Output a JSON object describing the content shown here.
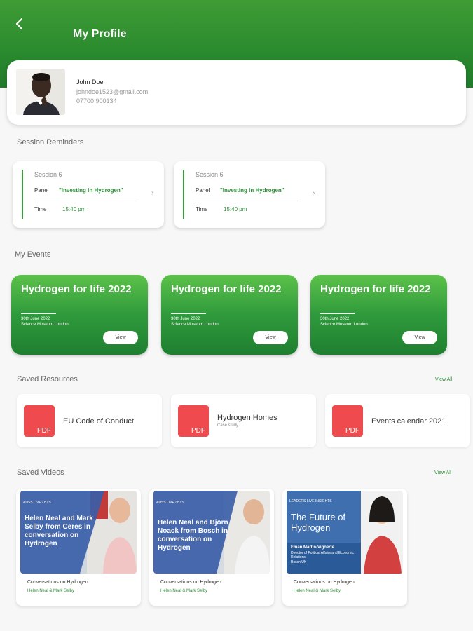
{
  "header": {
    "title": "My Profile",
    "back_icon": "chevron-left-icon"
  },
  "profile": {
    "name": "John Doe",
    "email": "johndoe1523@gmail.com",
    "phone": "07700 900134"
  },
  "sessions": {
    "title": "Session Reminders",
    "items": [
      {
        "title": "Session 6",
        "panel_label": "Panel",
        "panel_value": "\"Investing in Hydrogen\"",
        "time_label": "Time",
        "time_value": "15:40 pm"
      },
      {
        "title": "Session 6",
        "panel_label": "Panel",
        "panel_value": "\"Investing in Hydrogen\"",
        "time_label": "Time",
        "time_value": "15:40 pm"
      }
    ]
  },
  "events": {
    "title": "My Events",
    "items": [
      {
        "title": "Hydrogen for life 2022",
        "date": "30th June 2022",
        "location": "Science Museum London",
        "button": "View"
      },
      {
        "title": "Hydrogen for life 2022",
        "date": "30th June 2022",
        "location": "Science Museum London",
        "button": "View"
      },
      {
        "title": "Hydrogen for life 2022",
        "date": "30th June 2022",
        "location": "Science Museum London",
        "button": "View"
      }
    ]
  },
  "resources": {
    "title": "Saved Resources",
    "view_all": "View All",
    "items": [
      {
        "icon_label": "PDF",
        "title": "EU Code of Conduct",
        "subtitle": ""
      },
      {
        "icon_label": "PDF",
        "title": "Hydrogen Homes",
        "subtitle": "Case study"
      },
      {
        "icon_label": "PDF",
        "title": "Events calendar 2021",
        "subtitle": ""
      }
    ]
  },
  "videos": {
    "title": "Saved Videos",
    "view_all": "View All",
    "items": [
      {
        "thumb_tag": "ADSS LIVE / BTS",
        "thumb_text": "Helen Neal and Mark Selby from Ceres in conversation on Hydrogen",
        "title": "Conversations on Hydrogen",
        "subtitle": "Helen Neal & Mark Selby"
      },
      {
        "thumb_tag": "ADSS LIVE / BTS",
        "thumb_text": "Helen Neal and Björn Noack from Bosch in conversation on Hydrogen",
        "title": "Conversations on Hydrogen",
        "subtitle": "Helen Neal & Mark Selby"
      },
      {
        "thumb_tag": "LEADERS LIVE INSIGHTS",
        "thumb_text": "The Future of Hydrogen",
        "thumb_speaker": "Eman Martin-Vignerte",
        "thumb_role": "Director of Political Affairs and Economic Relations",
        "thumb_org": "Bosch UK",
        "title": "Conversations on Hydrogen",
        "subtitle": "Helen Neal & Mark Selby"
      }
    ]
  },
  "colors": {
    "brand_green": "#2f8f3a",
    "pdf_red": "#ef4b4f"
  }
}
